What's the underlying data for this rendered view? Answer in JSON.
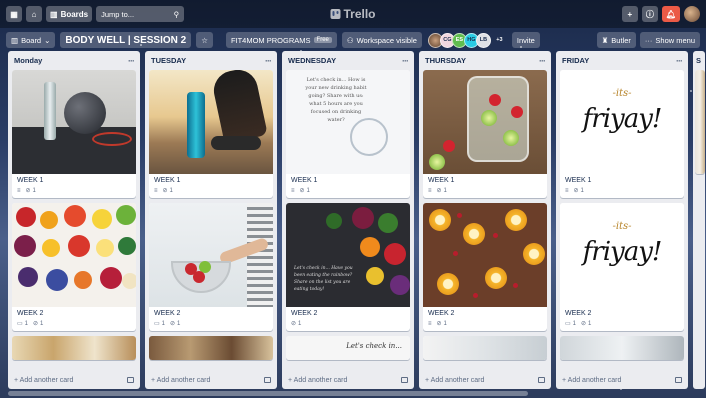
{
  "topbar": {
    "boards_label": "Boards",
    "search_placeholder": "Jump to...",
    "logo_text": "Trello"
  },
  "board": {
    "view_label": "Board",
    "title": "BODY WELL | SESSION 2",
    "workspace_name": "FIT4MOM PROGRAMS",
    "workspace_badge": "Free",
    "visibility_label": "Workspace visible",
    "members": [
      "CG",
      "ES",
      "HG",
      "LB"
    ],
    "members_more": "+3",
    "invite_label": "Invite",
    "butler_label": "Butler",
    "show_menu_label": "Show menu"
  },
  "lists": [
    {
      "name": "Monday",
      "cards": [
        {
          "title": "WEEK 1",
          "attachments": "1"
        },
        {
          "title": "WEEK 2",
          "comments": "1",
          "attachments": "1"
        }
      ],
      "add_label": "+ Add another card"
    },
    {
      "name": "TUESDAY",
      "cards": [
        {
          "title": "WEEK 1",
          "attachments": "1"
        },
        {
          "title": "WEEK 2",
          "comments": "1",
          "attachments": "1"
        }
      ],
      "add_label": "+ Add another card"
    },
    {
      "name": "WEDNESDAY",
      "cards": [
        {
          "title": "WEEK 1",
          "attachments": "1",
          "cover_text": "Let's check in... How is your new drinking habit going? Share with us: what 5 hours are you focused on drinking water?"
        },
        {
          "title": "WEEK 2",
          "attachments": "1",
          "cover_text": "Let's check in... Have you been eating the rainbow? Share on the list you are eating today!"
        }
      ],
      "stub_text": "Let's check in...",
      "add_label": "+ Add another card"
    },
    {
      "name": "THURSDAY",
      "cards": [
        {
          "title": "WEEK 1",
          "attachments": "1"
        },
        {
          "title": "WEEK 2",
          "attachments": "1"
        }
      ],
      "add_label": "+ Add another card"
    },
    {
      "name": "FRIDAY",
      "cards": [
        {
          "title": "WEEK 1",
          "attachments": "1",
          "cover_its": "-its-",
          "cover_word": "friyay!"
        },
        {
          "title": "WEEK 2",
          "comments": "1",
          "attachments": "1",
          "cover_its": "-its-",
          "cover_word": "friyay!"
        }
      ],
      "add_label": "+ Add another card"
    },
    {
      "name": "S"
    }
  ]
}
